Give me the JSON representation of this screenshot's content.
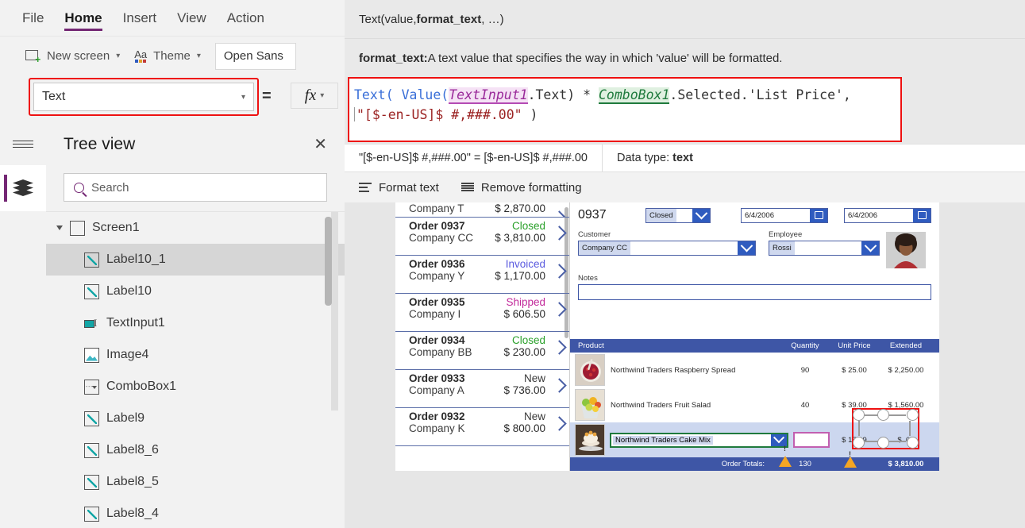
{
  "menu": {
    "items": [
      "File",
      "Home",
      "Insert",
      "View",
      "Action"
    ],
    "active": "Home"
  },
  "ribbon": {
    "new_screen": "New screen",
    "theme": "Theme",
    "font_name": "Open Sans"
  },
  "formula_bar": {
    "property": "Text",
    "equals": "=",
    "fx_label": "fx",
    "signature_prefix": "Text(value, ",
    "signature_bold": "format_text",
    "signature_suffix": ", …)",
    "desc_bold": "format_text:",
    "desc_text": " A text value that specifies the way in which 'value' will be formatted.",
    "code": {
      "l1_fn1": "Text(",
      "l1_fn2": " Value(",
      "l1_ctl1": "TextInput1",
      "l1_prop1": ".Text)",
      "l1_op": " * ",
      "l1_ctl2": "ComboBox1",
      "l1_prop2": ".Selected.'List Price',",
      "l2_str": "\"[$-en-US]$ #,###.00\"",
      "l2_close": " )"
    },
    "result_left": "\"[$-en-US]$ #,###.00\"  =  [$-en-US]$ #,###.00",
    "result_right_label": "Data type: ",
    "result_right_value": "text",
    "format_text": "Format text",
    "remove_formatting": "Remove formatting"
  },
  "tree": {
    "title": "Tree view",
    "search_placeholder": "Search",
    "root": "Screen1",
    "items": [
      {
        "label": "Label10_1",
        "icon": "label-icon",
        "selected": true
      },
      {
        "label": "Label10",
        "icon": "label-icon",
        "selected": false
      },
      {
        "label": "TextInput1",
        "icon": "textinput-icon",
        "selected": false
      },
      {
        "label": "Image4",
        "icon": "image-icon",
        "selected": false
      },
      {
        "label": "ComboBox1",
        "icon": "combobox-icon",
        "selected": false
      },
      {
        "label": "Label9",
        "icon": "label-icon",
        "selected": false
      },
      {
        "label": "Label8_6",
        "icon": "label-icon",
        "selected": false
      },
      {
        "label": "Label8_5",
        "icon": "label-icon",
        "selected": false
      },
      {
        "label": "Label8_4",
        "icon": "label-icon",
        "selected": false
      }
    ]
  },
  "app": {
    "orders": [
      {
        "number": "",
        "company": "Company T",
        "status": "",
        "status_color": "",
        "amount": "$ 2,870.00",
        "partial": true
      },
      {
        "number": "Order 0937",
        "company": "Company CC",
        "status": "Closed",
        "status_color": "#2aa02a",
        "amount": "$ 3,810.00",
        "partial": false
      },
      {
        "number": "Order 0936",
        "company": "Company Y",
        "status": "Invoiced",
        "status_color": "#5a5adf",
        "amount": "$ 1,170.00",
        "partial": false
      },
      {
        "number": "Order 0935",
        "company": "Company I",
        "status": "Shipped",
        "status_color": "#c2299a",
        "amount": "$ 606.50",
        "partial": false
      },
      {
        "number": "Order 0934",
        "company": "Company BB",
        "status": "Closed",
        "status_color": "#2aa02a",
        "amount": "$ 230.00",
        "partial": false
      },
      {
        "number": "Order 0933",
        "company": "Company A",
        "status": "New",
        "status_color": "#3a3a3a",
        "amount": "$ 736.00",
        "partial": false
      },
      {
        "number": "Order 0932",
        "company": "Company K",
        "status": "New",
        "status_color": "#3a3a3a",
        "amount": "$ 800.00",
        "partial": false
      }
    ],
    "detail": {
      "order_number": "0937",
      "status": "Closed",
      "date1": "6/4/2006",
      "date2": "6/4/2006",
      "customer_label": "Customer",
      "customer_value": "Company CC",
      "employee_label": "Employee",
      "employee_value": "Rossi",
      "notes_label": "Notes",
      "notes_value": "",
      "table_headers": [
        "Product",
        "Quantity",
        "Unit Price",
        "Extended"
      ],
      "rows": [
        {
          "product": "Northwind Traders Raspberry Spread",
          "quantity": "90",
          "unit_price": "$ 25.00",
          "extended": "$ 2,250.00"
        },
        {
          "product": "Northwind Traders Fruit Salad",
          "quantity": "40",
          "unit_price": "$ 39.00",
          "extended": "$ 1,560.00"
        }
      ],
      "edit_row": {
        "product": "Northwind Traders Cake Mix",
        "quantity": "",
        "unit_price": "$ 15.99",
        "extended": "$ .00"
      },
      "totals_label": "Order Totals:",
      "totals_quantity": "130",
      "totals_extended": "$ 3,810.00"
    }
  },
  "colors": {
    "accent_purple": "#742774",
    "selection_red": "#ee1111",
    "app_blue": "#3e56a6",
    "control_green": "#1f7a3d",
    "control_pink": "#c25fb0"
  }
}
